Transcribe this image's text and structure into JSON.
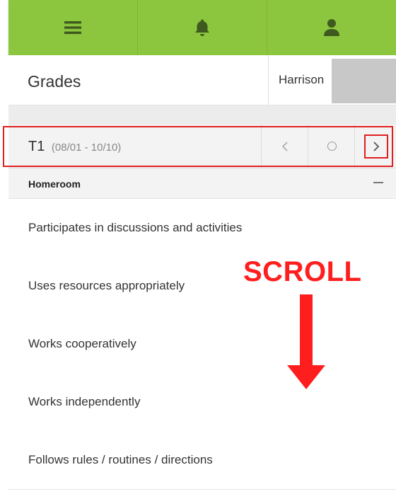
{
  "topbar": {
    "buttons": [
      {
        "icon": "menu-icon"
      },
      {
        "icon": "bell-icon"
      },
      {
        "icon": "user-icon"
      }
    ],
    "color": "#8cc63f"
  },
  "header": {
    "title": "Grades",
    "student_name": "Harrison"
  },
  "term": {
    "label": "T1",
    "dates": "(08/01 - 10/10)",
    "prev_label": "‹",
    "next_label": "›"
  },
  "section": {
    "title": "Homeroom"
  },
  "items": [
    {
      "label": "Participates in discussions and activities"
    },
    {
      "label": "Uses resources appropriately"
    },
    {
      "label": "Works cooperatively"
    },
    {
      "label": "Works independently"
    },
    {
      "label": "Follows rules / routines / directions"
    }
  ],
  "annotation": {
    "text": "SCROLL",
    "color": "#ff1e1e"
  }
}
